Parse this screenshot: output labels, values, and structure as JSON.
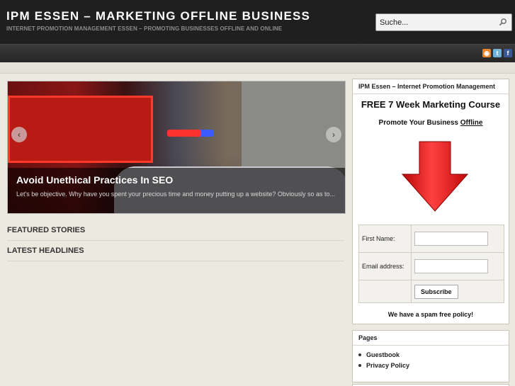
{
  "header": {
    "title": "IPM ESSEN – MARKETING OFFLINE BUSINESS",
    "tagline": "INTERNET PROMOTION MANAGEMENT ESSEN – PROMOTING BUSINESSES OFFLINE AND ONLINE",
    "search_placeholder": "Suche..."
  },
  "social_icons": [
    "rss-icon",
    "twitter-icon",
    "facebook-icon"
  ],
  "slider": {
    "title": "Avoid Unethical Practices In SEO",
    "excerpt": "Let's be objective. Why have you spent your precious time and money putting up a website? Obviously so as to...",
    "prev_icon": "‹",
    "next_icon": "›"
  },
  "sections": {
    "featured": "FEATURED STORIES",
    "latest": "LATEST HEADLINES"
  },
  "sidebar": {
    "course_widget": {
      "title": "IPM Essen – Internet Promotion Management",
      "heading": "FREE 7 Week Marketing Course",
      "sub_prefix": "Promote Your Business ",
      "sub_link": "Offline",
      "form": {
        "first_name_label": "First Name:",
        "email_label": "Email address:",
        "subscribe_label": "Subscribe"
      },
      "spam_note": "We have a spam free policy!"
    },
    "pages_widget": {
      "title": "Pages",
      "items": [
        "Guestbook",
        "Privacy Policy"
      ]
    }
  },
  "colors": {
    "header_bg": "#1f1f1f",
    "page_bg": "#ece9e0",
    "arrow_red": "#e01818"
  }
}
